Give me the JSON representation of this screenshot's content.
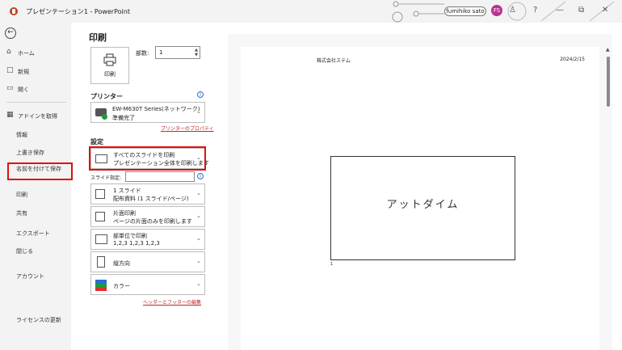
{
  "window": {
    "title": "プレゼンテーション1 - PowerPoint"
  },
  "account": {
    "user_name": "fumihiko sato",
    "initials": "FS"
  },
  "titlebar_buttons": {
    "help": "?",
    "minimize": "—",
    "restore": "⧉",
    "close": "✕"
  },
  "sidebar": {
    "back": "←",
    "items": [
      {
        "label": "ホーム",
        "icon": "⌂"
      },
      {
        "label": "新規",
        "icon": "□"
      },
      {
        "label": "開く",
        "icon": "▭"
      },
      {
        "label": "アドインを取得",
        "icon": "▦"
      },
      {
        "label": "情報"
      },
      {
        "label": "上書き保存"
      },
      {
        "label": "名前を付けて保存"
      },
      {
        "label": "印刷"
      },
      {
        "label": "共有"
      },
      {
        "label": "エクスポート"
      },
      {
        "label": "閉じる"
      },
      {
        "label": "アカウント"
      },
      {
        "label": "ライセンスの更新"
      }
    ]
  },
  "main": {
    "title": "印刷",
    "print_button": "印刷",
    "copies_label": "部数:",
    "copies_value": "1",
    "printer_heading": "プリンター",
    "info_glyph": "i",
    "printer_name": "EW-M630T Series(ネットワーク)",
    "printer_status": "準備完了",
    "printer_properties": "プリンターのプロパティ",
    "settings_heading": "設定",
    "settings": [
      {
        "line1": "すべてのスライドを印刷",
        "line2": "プレゼンテーション全体を印刷します"
      },
      {
        "line1": "1 スライド",
        "line2": "配布資料 (1 スライド/ページ)"
      },
      {
        "line1": "片面印刷",
        "line2": "ページの片面のみを印刷します"
      },
      {
        "line1": "部単位で印刷",
        "line2": "1,2,3    1,2,3    1,2,3"
      },
      {
        "line1": "縦方向"
      },
      {
        "line1": "カラー"
      }
    ],
    "slide_spec_label": "スライド指定:",
    "slide_spec_value": "",
    "header_footer_link": "ヘッダーとフッターの編集"
  },
  "preview": {
    "company": "株式会社ステム",
    "date": "2024/2/15",
    "slide_text": "アットダイム",
    "page_number": "1"
  },
  "colors": {
    "accent_red": "#c4272c",
    "highlight": "#e01010",
    "printer_ok": "#1d9a3a",
    "avatar": "#b7338e"
  }
}
